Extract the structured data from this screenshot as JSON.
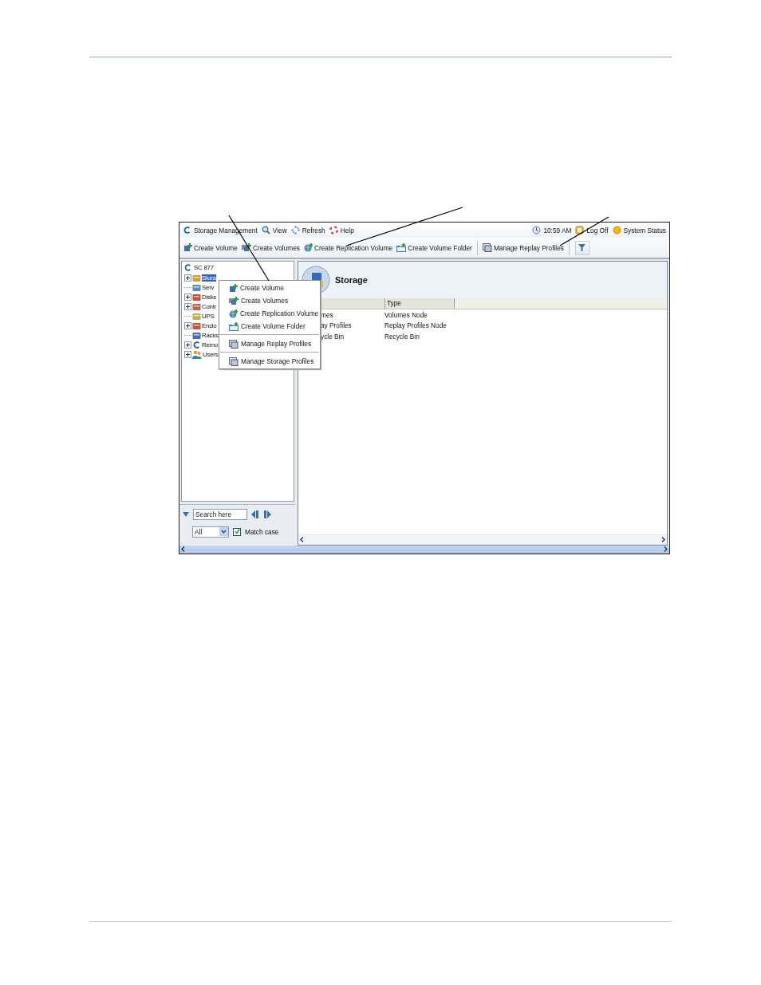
{
  "menubar": {
    "items": [
      "Storage Management",
      "View",
      "Refresh",
      "Help"
    ],
    "clock": "10:59 AM",
    "logoff": "Log Off",
    "status": "System Status"
  },
  "toolbar": {
    "groups": [
      [
        "Create Volume",
        "Create Volumes",
        "Create Replication Volume",
        "Create Volume Folder"
      ],
      [
        "Manage Replay Profiles"
      ]
    ]
  },
  "tree": {
    "label": "SC 877",
    "children": [
      {
        "label": "Stora",
        "expander": true,
        "selected": true
      },
      {
        "label": "Serv",
        "expander": false,
        "selected": false
      },
      {
        "label": "Disks",
        "expander": true,
        "selected": false
      },
      {
        "label": "Contr",
        "expander": true,
        "selected": false
      },
      {
        "label": "UPS",
        "expander": false,
        "selected": false
      },
      {
        "label": "Enclo",
        "expander": true,
        "selected": false
      },
      {
        "label": "Racks",
        "expander": false,
        "selected": false
      },
      {
        "label": "Remo",
        "expander": true,
        "selected": false
      },
      {
        "label": "Users",
        "expander": true,
        "selected": false
      }
    ]
  },
  "search": {
    "placeholder": "Search here",
    "scope": "All",
    "match_case": {
      "label": "Match case",
      "checked": true
    }
  },
  "context_menu": {
    "groups": [
      [
        "Create Volume",
        "Create Volumes",
        "Create Replication Volume",
        "Create Volume Folder"
      ],
      [
        "Manage Replay Profiles"
      ],
      [
        "Manage Storage Profiles"
      ]
    ]
  },
  "detail": {
    "title": "Storage",
    "columns": [
      "Type"
    ],
    "rows": [
      {
        "column_1": "mes",
        "type": "Volumes Node"
      },
      {
        "column_1": "ay Profiles",
        "type": "Replay Profiles Node"
      },
      {
        "column_1": "ycle Bin",
        "type": "Recycle Bin"
      }
    ]
  }
}
